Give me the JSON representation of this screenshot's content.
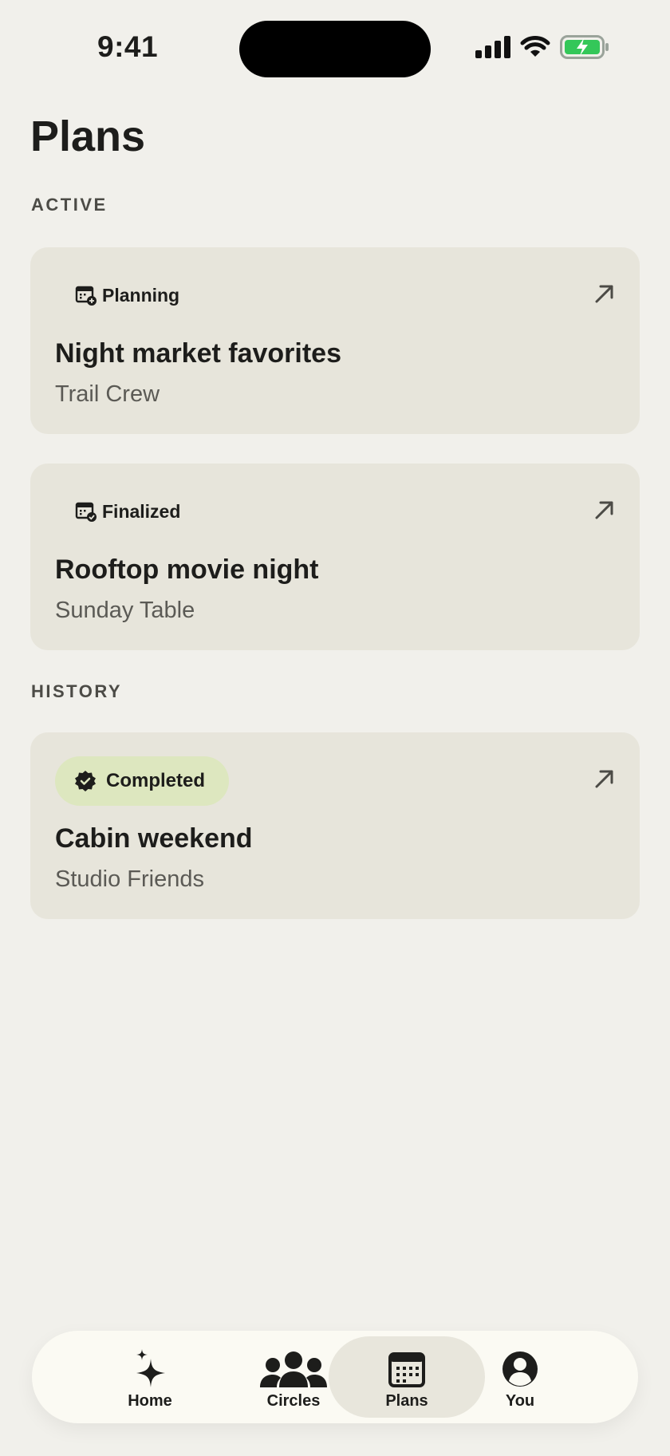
{
  "status_bar": {
    "time": "9:41",
    "battery_color": "#34c759"
  },
  "page": {
    "title": "Plans"
  },
  "sections": {
    "active_label": "ACTIVE",
    "history_label": "HISTORY"
  },
  "plans": [
    {
      "status": "Planning",
      "status_icon": "calendar-plus-icon",
      "title": "Night market favorites",
      "circle": "Trail Crew"
    },
    {
      "status": "Finalized",
      "status_icon": "calendar-check-icon",
      "title": "Rooftop movie night",
      "circle": "Sunday Table"
    },
    {
      "status": "Completed",
      "status_icon": "verified-badge-icon",
      "title": "Cabin weekend",
      "circle": "Studio Friends",
      "status_color": "#dde7bf"
    }
  ],
  "tab_bar": {
    "tabs": [
      {
        "label": "Home",
        "icon": "sparkle-icon"
      },
      {
        "label": "Circles",
        "icon": "people-group-icon"
      },
      {
        "label": "Plans",
        "icon": "calendar-icon",
        "active": true
      },
      {
        "label": "You",
        "icon": "person-circle-icon"
      }
    ]
  }
}
